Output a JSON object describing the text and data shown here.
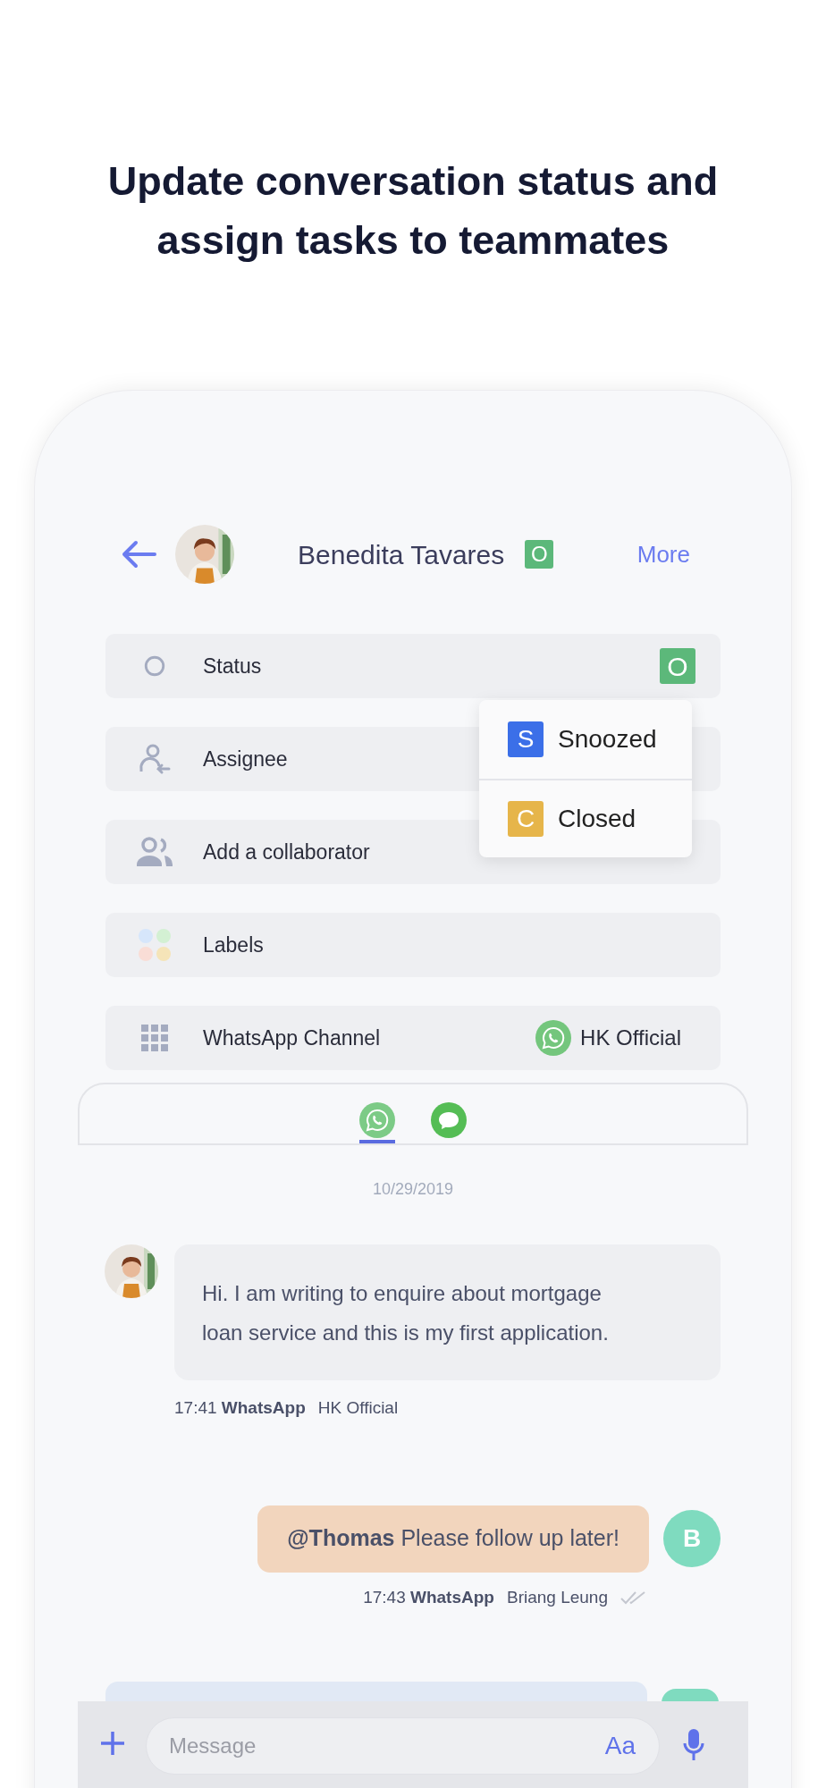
{
  "heading": "Update conversation status and assign tasks to teammates",
  "contact": {
    "name": "Benedita Tavares",
    "status_badge": "O",
    "more": "More"
  },
  "fields": [
    {
      "kind": "status",
      "label": "Status",
      "badge": "O"
    },
    {
      "kind": "assignee",
      "label": "Assignee"
    },
    {
      "kind": "collaborator",
      "label": "Add a collaborator"
    },
    {
      "kind": "labels",
      "label": "Labels"
    },
    {
      "kind": "channel",
      "label": "WhatsApp Channel",
      "value": "HK Official"
    }
  ],
  "status_menu": [
    {
      "letter": "S",
      "label": "Snoozed",
      "color": "#3b6fe8"
    },
    {
      "letter": "C",
      "label": "Closed",
      "color": "#e6b54a"
    }
  ],
  "channel_tabs": [
    {
      "kind": "whatsapp",
      "selected": true
    },
    {
      "kind": "sms",
      "selected": false
    }
  ],
  "date": "10/29/2019",
  "messages": [
    {
      "kind": "incoming",
      "text": "Hi. I am writing to enquire about mortgage loan service and this is my first application.",
      "time": "17:41",
      "channel": "WhatsApp",
      "sender": "HK Official"
    },
    {
      "kind": "outgoing",
      "avatar_letter": "B",
      "text": "**@Thomas** Please follow up later!",
      "time": "17:43",
      "channel": "WhatsApp",
      "sender": "Briang Leung"
    }
  ],
  "composer": {
    "placeholder": "Message",
    "format_button": "Aa"
  }
}
